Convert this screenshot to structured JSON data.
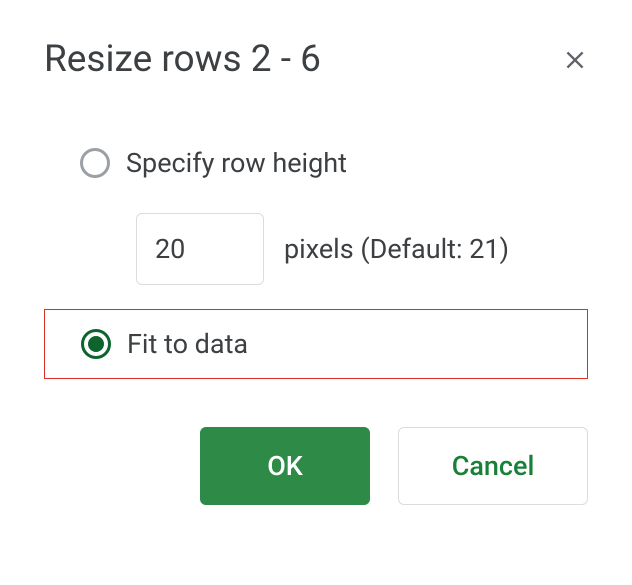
{
  "dialog": {
    "title": "Resize rows 2 - 6"
  },
  "options": {
    "specify": {
      "label": "Specify row height",
      "value": "20",
      "suffix": "pixels (Default: 21)"
    },
    "fit": {
      "label": "Fit to data"
    }
  },
  "buttons": {
    "ok": "OK",
    "cancel": "Cancel"
  }
}
